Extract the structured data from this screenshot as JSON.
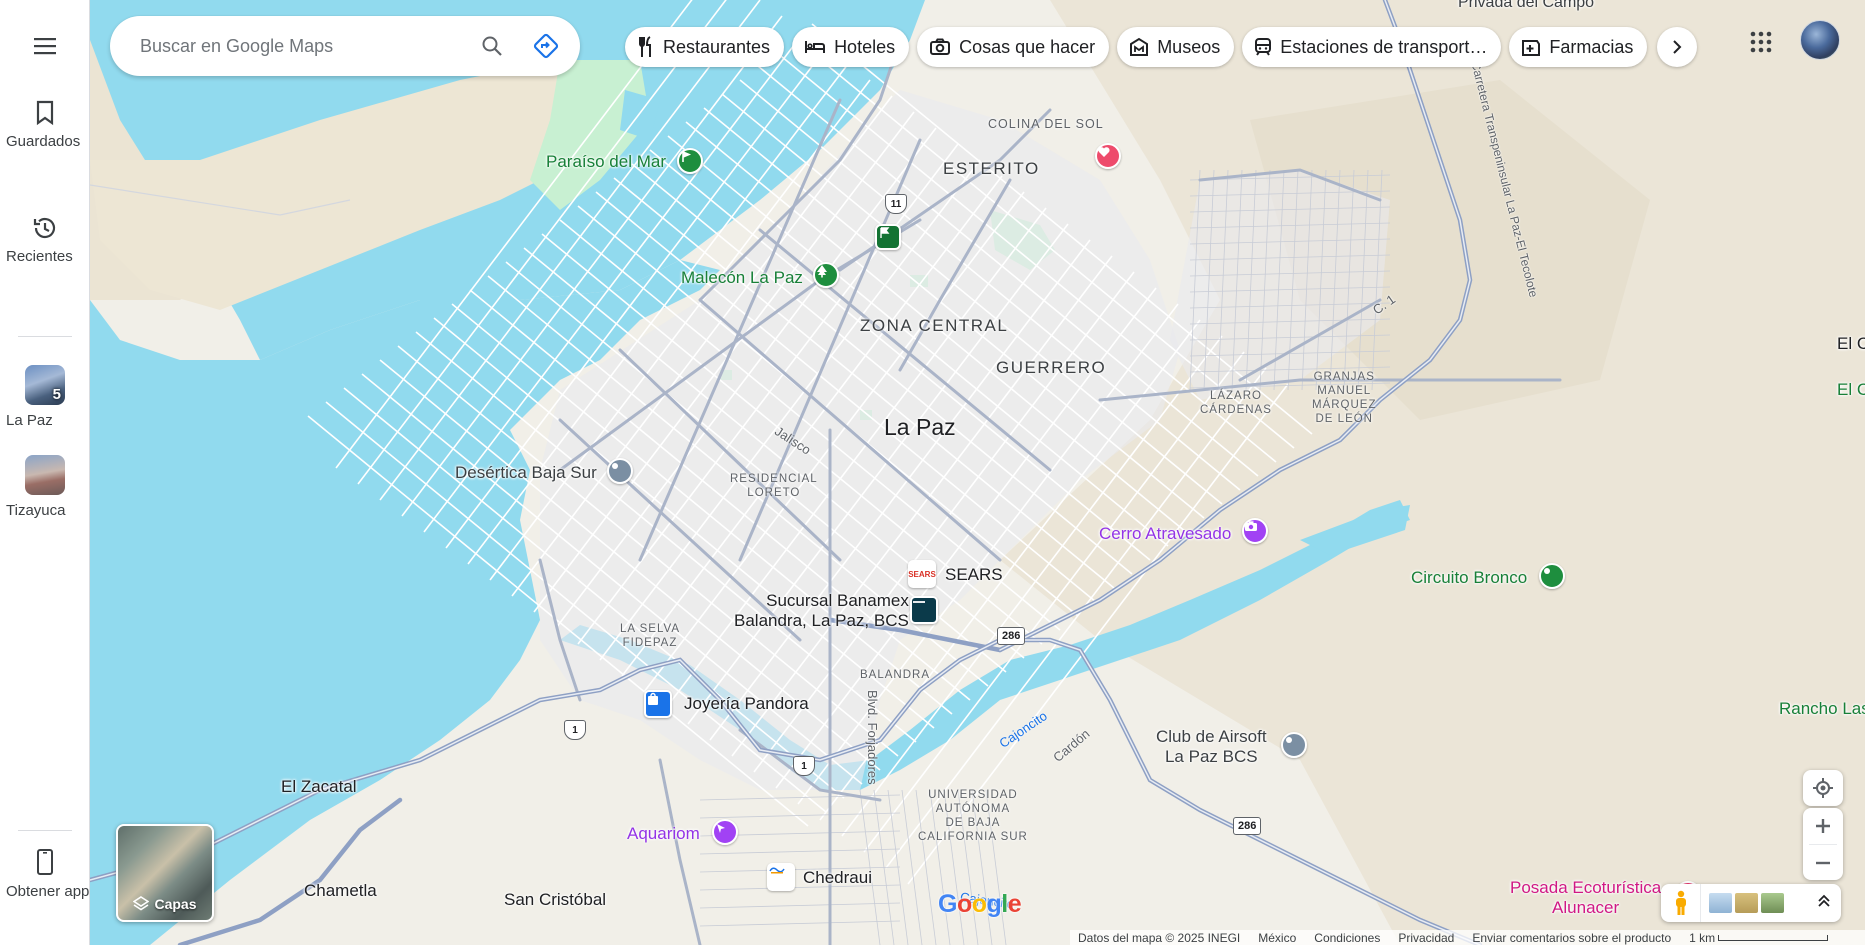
{
  "rail": {
    "saved_label": "Guardados",
    "recents_label": "Recientes",
    "recent_places": [
      {
        "label": "La Paz",
        "badge": "5"
      },
      {
        "label": "Tizayuca"
      }
    ],
    "get_app_label": "Obtener app"
  },
  "search": {
    "placeholder": "Buscar en Google Maps"
  },
  "chips": [
    {
      "label": "Restaurantes",
      "icon": "fork-knife-icon"
    },
    {
      "label": "Hoteles",
      "icon": "bed-icon"
    },
    {
      "label": "Cosas que hacer",
      "icon": "camera-icon"
    },
    {
      "label": "Museos",
      "icon": "museum-icon"
    },
    {
      "label": "Estaciones de transport…",
      "icon": "train-icon"
    },
    {
      "label": "Farmacias",
      "icon": "pharmacy-icon"
    }
  ],
  "map": {
    "top_street": "Privada del Campo",
    "city": "La Paz",
    "neighborhoods": {
      "esterito": "ESTERITO",
      "colina_del_sol": "COLINA DEL SOL",
      "zona_central": "ZONA CENTRAL",
      "guerrero": "GUERRERO",
      "residencial_loreto": "RESIDENCIAL\nLORETO",
      "lazaro_cardenas": "LÁZARO\nCÁRDENAS",
      "granjas": "GRANJAS\nMANUEL\nMÁRQUEZ\nDE LEÓN",
      "la_selva": "LA SELVA\nFIDEPAZ",
      "balandra": "BALANDRA",
      "universidad": "UNIVERSIDAD\nAUTÓNOMA\nDE BAJA\nCALIFORNIA SUR"
    },
    "places": {
      "paraiso": "Paraíso del Mar",
      "malecon": "Malecón La Paz",
      "desertica": "Desértica Baja Sur",
      "cerro": "Cerro Atravesado",
      "circuito": "Circuito Bronco",
      "el_cajoncito_area": "El Cajoncito",
      "el_cajoncito_pin": "El Cajoncito",
      "rancho": "Rancho Las Potrancas",
      "sears": "SEARS",
      "sears_logo": "SEARS",
      "banamex": "Sucursal Banamex\nBalandra, La Paz, BCS",
      "pandora": "Joyería Pandora",
      "airsoft": "Club de Airsoft\nLa Paz BCS",
      "aquariom": "Aquariom",
      "chedraui": "Chedraui",
      "posada": "Posada Ecoturística\nAlunacer",
      "el_zacatal": "El Zacatal",
      "chametla": "Chametla",
      "san_cristobal": "San Cristóbal"
    },
    "roads": {
      "jalisco": "Jalisco",
      "blvd_forjadores": "Blvd. Forjadores",
      "carretera": "Carretera Transpeninsular La Paz-El Tecolote",
      "c1": "C. 1",
      "cardon": "Cardón",
      "cajoncito_1": "Cajoncito",
      "cajoncito_2": "Cajoncito"
    },
    "shields": {
      "hwy11": "11",
      "hwy1a": "1",
      "hwy1b": "1",
      "hwy286a": "286",
      "hwy286b": "286"
    }
  },
  "layers_label": "Capas",
  "google_logo": [
    "G",
    "o",
    "o",
    "g",
    "l",
    "e"
  ],
  "footer": {
    "data": "Datos del mapa © 2025 INEGI",
    "country": "México",
    "terms": "Condiciones",
    "privacy": "Privacidad",
    "feedback": "Enviar comentarios sobre el producto",
    "scale": "1 km"
  },
  "colors": {
    "water": "#91daee",
    "land": "#f1efe8",
    "park": "#c8f0d2",
    "road": "#aab4c8",
    "highway": "#8ea0c4"
  }
}
